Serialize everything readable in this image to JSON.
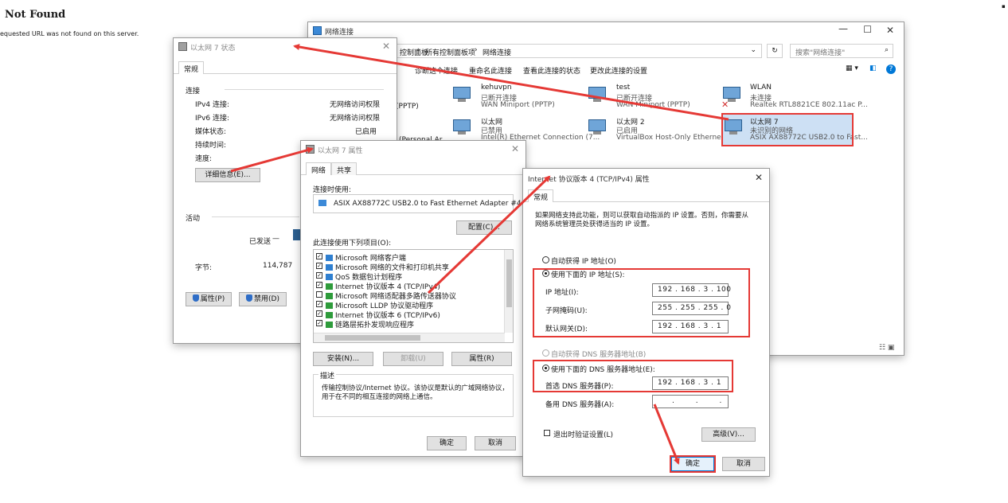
{
  "browser_page": {
    "heading": "Not Found",
    "message": "equested URL was not found on this server."
  },
  "network_window": {
    "title": "网络连接",
    "breadcrumb": [
      "控制面板",
      "所有控制面板项",
      "网络连接"
    ],
    "breadcrumb_sep": "›",
    "search_placeholder": "搜索\"网络连接\"",
    "toolbar": [
      "诊断这个连接",
      "重命名此连接",
      "查看此连接的状态",
      "更改此连接的设置"
    ],
    "adapters": [
      {
        "name": "kehuvpn",
        "status": "已断开连接",
        "device": "WAN Miniport (PPTP)"
      },
      {
        "name": "test",
        "status": "已断开连接",
        "device": "WAN Miniport (PPTP)"
      },
      {
        "name": "WLAN",
        "status": "未连接",
        "device": "Realtek RTL8821CE 802.11ac P..."
      },
      {
        "name": "以太网",
        "status": "已禁用",
        "device": "Intel(R) Ethernet Connection (7..."
      },
      {
        "name": "以太网 2",
        "status": "已启用",
        "device": "VirtualBox Host-Only Ethernet ..."
      },
      {
        "name": "以太网 7",
        "status": "未识别的网络",
        "device": "ASIX AX88772C USB2.0 to Fast..."
      }
    ],
    "partial_left": [
      "(PPTP)",
      "(Personal Ar"
    ]
  },
  "status_window": {
    "title": "以太网 7 状态",
    "tab": "常规",
    "section_connection": "连接",
    "rows": [
      {
        "label": "IPv4 连接:",
        "value": "无网络访问权限"
      },
      {
        "label": "IPv6 连接:",
        "value": "无网络访问权限"
      },
      {
        "label": "媒体状态:",
        "value": "已启用"
      },
      {
        "label": "持续时间:",
        "value": ""
      },
      {
        "label": "速度:",
        "value": ""
      }
    ],
    "details_button": "详细信息(E)...",
    "section_activity": "活动",
    "sent_label": "已发送",
    "bytes_label": "字节:",
    "bytes_value": "114,787",
    "properties_button": "属性(P)",
    "disable_button": "禁用(D)"
  },
  "props_window": {
    "title": "以太网 7 属性",
    "tabs": [
      "网络",
      "共享"
    ],
    "connect_using_label": "连接时使用:",
    "adapter_name": "ASIX AX88772C USB2.0 to Fast Ethernet Adapter #4",
    "configure_button": "配置(C)...",
    "items_label": "此连接使用下列项目(O):",
    "items": [
      {
        "label": "Microsoft 网络客户端",
        "checked": true
      },
      {
        "label": "Microsoft 网络的文件和打印机共享",
        "checked": true
      },
      {
        "label": "QoS 数据包计划程序",
        "checked": true
      },
      {
        "label": "Internet 协议版本 4 (TCP/IPv4)",
        "checked": true
      },
      {
        "label": "Microsoft 网络适配器多路传送器协议",
        "checked": false
      },
      {
        "label": "Microsoft LLDP 协议驱动程序",
        "checked": true
      },
      {
        "label": "Internet 协议版本 6 (TCP/IPv6)",
        "checked": true
      },
      {
        "label": "链路层拓扑发现响应程序",
        "checked": true
      }
    ],
    "install_button": "安装(N)...",
    "uninstall_button": "卸载(U)",
    "properties_button": "属性(R)",
    "description_label": "描述",
    "description_text": "传输控制协议/Internet 协议。该协议是默认的广域网络协议，用于在不同的相互连接的网络上通信。",
    "ok_button": "确定",
    "cancel_button": "取消"
  },
  "ipv4_window": {
    "title": "Internet 协议版本 4 (TCP/IPv4) 属性",
    "tab": "常规",
    "intro": "如果网络支持此功能，则可以获取自动指派的 IP 设置。否则，你需要从网络系统管理员处获得适当的 IP 设置。",
    "auto_ip": "自动获得 IP 地址(O)",
    "manual_ip": "使用下面的 IP 地址(S):",
    "ip_label": "IP 地址(I):",
    "ip_value": "192 . 168 . 3 . 100",
    "mask_label": "子网掩码(U):",
    "mask_value": "255 . 255 . 255 . 0",
    "gateway_label": "默认网关(D):",
    "gateway_value": "192 . 168 . 3 . 1",
    "auto_dns": "自动获得 DNS 服务器地址(B)",
    "manual_dns": "使用下面的 DNS 服务器地址(E):",
    "pref_dns_label": "首选 DNS 服务器(P):",
    "pref_dns_value": "192 . 168 . 3 . 1",
    "alt_dns_label": "备用 DNS 服务器(A):",
    "alt_dns_value": ". . .",
    "validate_label": "退出时验证设置(L)",
    "advanced_button": "高级(V)...",
    "ok_button": "确定",
    "cancel_button": "取消"
  },
  "colors": {
    "annotation_red": "#e53935",
    "accent_blue": "#0078d7"
  }
}
